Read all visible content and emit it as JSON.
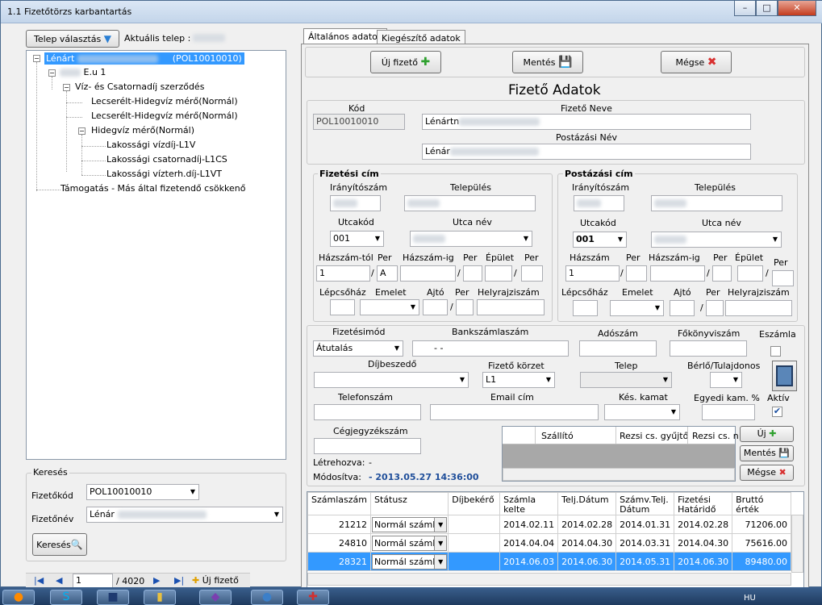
{
  "window": {
    "title": "1.1 Fizetőtörzs karbantartás",
    "min": "–",
    "max": "□",
    "close": "✕"
  },
  "left": {
    "telep_button": "Telep választás",
    "telep_label": "Aktuális telep :",
    "tree": [
      {
        "label": "Lénárt",
        "code": "(POL10010010)",
        "level": 0,
        "selected": true,
        "expander": "−"
      },
      {
        "label": "E.u 1",
        "level": 1,
        "expander": "−"
      },
      {
        "label": "Víz- és Csatornadíj szerződés",
        "level": 2,
        "expander": "−"
      },
      {
        "label": "Lecserélt-Hidegvíz mérő(Normál)",
        "level": 3
      },
      {
        "label": "Lecserélt-Hidegvíz mérő(Normál)",
        "level": 3
      },
      {
        "label": "Hidegvíz mérő(Normál)",
        "level": 3,
        "expander": "−"
      },
      {
        "label": "Lakossági vízdíj-L1V",
        "level": 4
      },
      {
        "label": "Lakossági csatornadíj-L1CS",
        "level": 4
      },
      {
        "label": "Lakossági vízterh.díj-L1VT",
        "level": 4
      },
      {
        "label": "Támogatás - Más által fizetendő csökkenő",
        "level": 1
      }
    ],
    "search": {
      "title": "Keresés",
      "code_label": "Fizetőkód",
      "code_value": "POL10010010",
      "name_label": "Fizetőnév",
      "name_value": "Lénár",
      "button": "Keresés"
    },
    "nav": {
      "position": "1",
      "total": "/ 4020",
      "new_label": "Új fizető"
    }
  },
  "tabs": [
    {
      "label": "Általános adatok",
      "active": true
    },
    {
      "label": "Kiegészítő adatok",
      "active": false
    }
  ],
  "toolbar": {
    "new": "Új fizető",
    "save": "Mentés",
    "cancel": "Mégse"
  },
  "form": {
    "title": "Fizető Adatok",
    "kod_label": "Kód",
    "kod_value": "POL10010010",
    "fizneve_label": "Fizető Neve",
    "fizneve_value": "Lénártn",
    "postnev_label": "Postázási Név",
    "postnev_value": "Lénár"
  },
  "fizcim": {
    "title": "Fizetési cím",
    "irsz": "Irányítószám",
    "irsz_value": "",
    "telep": "Település",
    "utcakod": "Utcakód",
    "utcakod_value": "001",
    "utcanev": "Utca név",
    "hazszam_tol": "Házszám-tól",
    "per": "Per",
    "per_value": "A",
    "hazszam_ig": "Házszám-ig",
    "epulet": "Épület",
    "hazszam_value": "1",
    "lepcsohaz": "Lépcsőház",
    "emelet": "Emelet",
    "ajto": "Ajtó",
    "hrsz": "Helyrajziszám",
    "slash": "/"
  },
  "postcim": {
    "title": "Postázási cím",
    "irsz": "Irányítószám",
    "telep": "Település",
    "utcakod": "Utcakód",
    "utcakod_value": "001",
    "utcanev": "Utca név",
    "hazszam": "Házszám",
    "per": "Per",
    "hazszam_ig": "Házszám-ig",
    "epulet": "Épület",
    "hazszam_value": "1",
    "lepcsohaz": "Lépcsőház",
    "emelet": "Emelet",
    "ajto": "Ajtó",
    "hrsz": "Helyrajziszám",
    "slash": "/"
  },
  "extra": {
    "fizmod": "Fizetésimód",
    "fizmod_value": "Átutalás",
    "bankszamla": "Bankszámlaszám",
    "bankszamla_value": "-   -",
    "adoszam": "Adószám",
    "fokonyv": "Főkönyviszám",
    "eszamla": "Eszámla",
    "dijbeszedo": "Díjbeszedő",
    "korzet": "Fizető körzet",
    "korzet_value": "L1",
    "telep": "Telep",
    "berlo": "Bérlő/Tulajdonos",
    "telefon": "Telefonszám",
    "email": "Email cím",
    "kes_kamat": "Kés. kamat",
    "egyedi": "Egyedi kam. %",
    "aktiv": "Aktív",
    "cegjegyzek": "Cégjegyzékszám",
    "letrehozva": "Létrehozva:",
    "letrehozva_value": "-",
    "modositva": "Módosítva:",
    "modositva_value": "- 2013.05.27 14:36:00",
    "sub_cols": [
      "",
      "Szállító",
      "Rezsi cs. gyűjtő",
      "Rezsi cs. n"
    ],
    "sub_new": "Új",
    "sub_save": "Mentés",
    "sub_cancel": "Mégse"
  },
  "invoices": {
    "columns": [
      "Számlaszám",
      "Státusz",
      "Díjbekérő",
      "Számla kelte",
      "Telj.Dátum",
      "Számv.Telj. Dátum",
      "Fizetési Határidő",
      "Bruttó érték"
    ],
    "rows": [
      {
        "szam": "21212",
        "status": "Normál számla",
        "kelte": "2014.02.11",
        "telj": "2014.02.28",
        "szamv": "2014.01.31",
        "hatarido": "2014.02.28",
        "brutto": "71206.00"
      },
      {
        "szam": "24810",
        "status": "Normál számla",
        "kelte": "2014.04.04",
        "telj": "2014.04.30",
        "szamv": "2014.03.31",
        "hatarido": "2014.04.30",
        "brutto": "75616.00"
      },
      {
        "szam": "28321",
        "status": "Normál számla",
        "kelte": "2014.06.03",
        "telj": "2014.06.30",
        "szamv": "2014.05.31",
        "hatarido": "2014.06.30",
        "brutto": "89480.00",
        "selected": true
      }
    ]
  },
  "taskbar": {
    "lang": "HU",
    "icons": [
      "firefox-icon",
      "skype-icon",
      "floppy-icon",
      "files-icon",
      "visual-studio-icon",
      "thunderbird-icon",
      "app-icon"
    ]
  },
  "colors": {
    "selection": "#3399ff",
    "title_bar": "#c3d5ea",
    "modified_date": "#1f4e9a"
  }
}
